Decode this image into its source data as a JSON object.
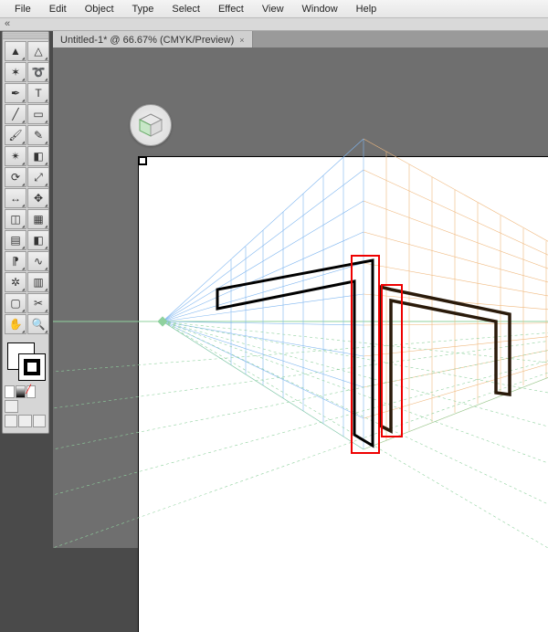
{
  "menubar": [
    "File",
    "Edit",
    "Object",
    "Type",
    "Select",
    "Effect",
    "View",
    "Window",
    "Help"
  ],
  "tab": {
    "label": "Untitled-1* @ 66.67% (CMYK/Preview)",
    "close": "×"
  },
  "tools": {
    "rows": [
      [
        "selection",
        "direct-selection"
      ],
      [
        "magic-wand",
        "lasso"
      ],
      [
        "pen",
        "type"
      ],
      [
        "line-segment",
        "rectangle"
      ],
      [
        "paintbrush",
        "pencil"
      ],
      [
        "blob-brush",
        "eraser"
      ],
      [
        "rotate",
        "scale"
      ],
      [
        "width",
        "free-transform"
      ],
      [
        "shape-builder",
        "perspective-grid"
      ],
      [
        "mesh",
        "gradient"
      ],
      [
        "eyedropper",
        "blend"
      ],
      [
        "symbol-sprayer",
        "column-graph"
      ],
      [
        "artboard",
        "slice"
      ],
      [
        "hand",
        "zoom"
      ]
    ]
  },
  "icons": {
    "selection": "▲",
    "direct-selection": "△",
    "magic-wand": "✶",
    "lasso": "➰",
    "pen": "✒",
    "type": "T",
    "line-segment": "╱",
    "rectangle": "▭",
    "paintbrush": "🖌",
    "pencil": "✎",
    "blob-brush": "✴",
    "eraser": "◧",
    "rotate": "⟳",
    "scale": "⤢",
    "width": "↔",
    "free-transform": "✥",
    "shape-builder": "◫",
    "perspective-grid": "▦",
    "mesh": "▤",
    "gradient": "◧",
    "eyedropper": "⁋",
    "blend": "∿",
    "symbol-sprayer": "✲",
    "column-graph": "▥",
    "artboard": "▢",
    "slice": "✂",
    "hand": "✋",
    "zoom": "🔍"
  },
  "colors": {
    "gridLeft": "#7fb6f0",
    "gridRight": "#f0b97f",
    "horizon": "#8fd19e",
    "highlight": "#e00000"
  }
}
